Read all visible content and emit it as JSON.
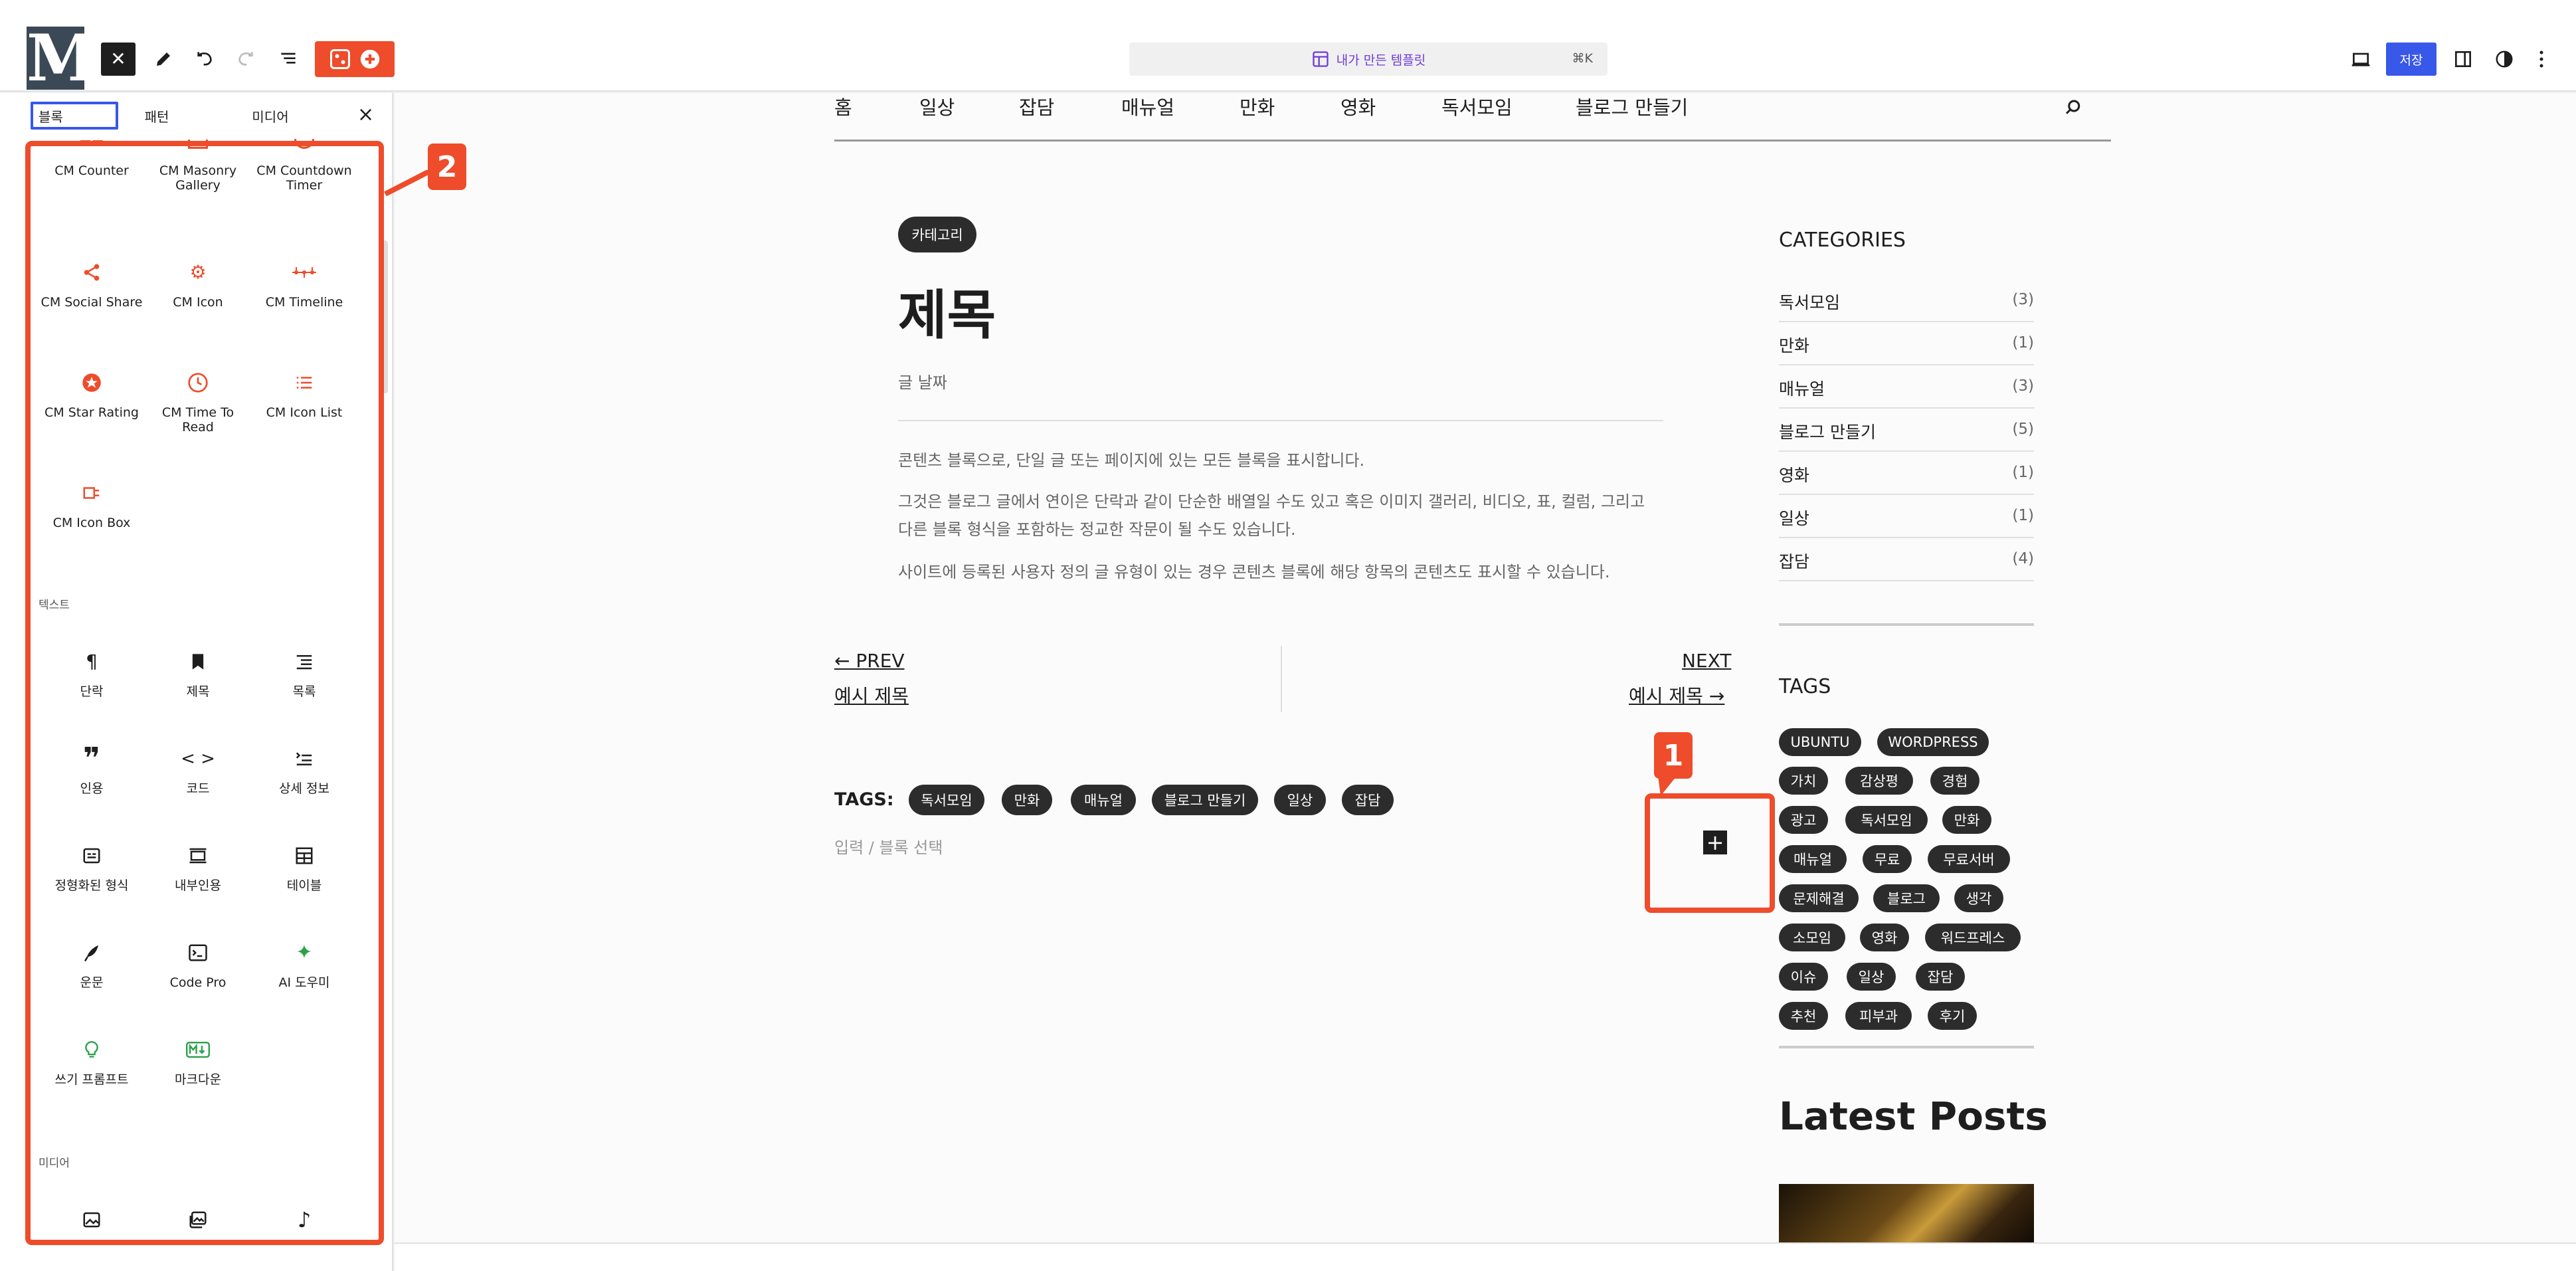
{
  "toolbar": {
    "logo_letter": "M",
    "template_label": "내가 만든 템플릿",
    "shortcut": "⌘K",
    "save_label": "저장",
    "accent": "#ee4c2b",
    "primary": "#3858e9"
  },
  "inserter": {
    "tabs": [
      {
        "label": "블록"
      },
      {
        "label": "패턴"
      },
      {
        "label": "미디어"
      }
    ],
    "blocks": [
      {
        "label": "CM Counter",
        "icon": "counter-icon"
      },
      {
        "label": "CM Masonry Gallery",
        "icon": "masonry-icon"
      },
      {
        "label": "CM Countdown Timer",
        "icon": "timer-icon"
      },
      {
        "label": "CM Social Share",
        "icon": "share-icon"
      },
      {
        "label": "CM Icon",
        "icon": "gear-icon"
      },
      {
        "label": "CM Timeline",
        "icon": "timeline-icon"
      },
      {
        "label": "CM Star Rating",
        "icon": "star-icon"
      },
      {
        "label": "CM Time To Read",
        "icon": "clock-icon"
      },
      {
        "label": "CM Icon List",
        "icon": "list-icon"
      },
      {
        "label": "CM Icon Box",
        "icon": "icon-box-icon"
      }
    ],
    "text_category": "텍스트",
    "text_blocks": [
      {
        "label": "단락",
        "icon": "pilcrow-icon"
      },
      {
        "label": "제목",
        "icon": "bookmark-icon"
      },
      {
        "label": "목록",
        "icon": "list-icon"
      },
      {
        "label": "인용",
        "icon": "quote-icon"
      },
      {
        "label": "코드",
        "icon": "code-icon"
      },
      {
        "label": "상세 정보",
        "icon": "details-icon"
      },
      {
        "label": "정형화된 형식",
        "icon": "preformatted-icon"
      },
      {
        "label": "내부인용",
        "icon": "pullquote-icon"
      },
      {
        "label": "테이블",
        "icon": "table-icon"
      },
      {
        "label": "운문",
        "icon": "quill-icon"
      },
      {
        "label": "Code Pro",
        "icon": "terminal-icon"
      },
      {
        "label": "AI 도우미",
        "icon": "sparkle-icon"
      },
      {
        "label": "쓰기 프롬프트",
        "icon": "bulb-icon"
      },
      {
        "label": "마크다운",
        "icon": "markdown-icon"
      }
    ],
    "media_category": "미디어"
  },
  "annotations": {
    "badge1": "1",
    "badge2": "2"
  },
  "nav": [
    "홈",
    "일상",
    "잡담",
    "매뉴얼",
    "만화",
    "영화",
    "독서모임",
    "블로그 만들기"
  ],
  "post": {
    "category": "카테고리",
    "title": "제목",
    "date": "글 날짜",
    "paragraphs": [
      "콘텐츠 블록으로, 단일 글 또는 페이지에 있는 모든 블록을 표시합니다.",
      "그것은 블로그 글에서 연이은 단락과 같이 단순한 배열일 수도 있고 혹은 이미지 갤러리, 비디오, 표, 컬럼, 그리고 다른 블록 형식을 포함하는 정교한 작문이 될 수도 있습니다.",
      "사이트에 등록된 사용자 정의 글 유형이 있는 경우 콘텐츠 블록에 해당 항목의 콘텐츠도 표시할 수 있습니다."
    ],
    "prev_label": "← PREV",
    "prev_title": "예시 제목",
    "next_label": "NEXT",
    "next_title": "예시 제목 →",
    "tags_label": "TAGS:",
    "tags": [
      "독서모임",
      "만화",
      "매뉴얼",
      "블로그 만들기",
      "일상",
      "잡담"
    ],
    "input_hint": "입력 / 블록 선택"
  },
  "sidebar": {
    "categories_title": "CATEGORIES",
    "categories": [
      {
        "name": "독서모임",
        "count": "(3)"
      },
      {
        "name": "만화",
        "count": "(1)"
      },
      {
        "name": "매뉴얼",
        "count": "(3)"
      },
      {
        "name": "블로그 만들기",
        "count": "(5)"
      },
      {
        "name": "영화",
        "count": "(1)"
      },
      {
        "name": "일상",
        "count": "(1)"
      },
      {
        "name": "잡담",
        "count": "(4)"
      }
    ],
    "tags_title": "TAGS",
    "tags": [
      "UBUNTU",
      "WORDPRESS",
      "가치",
      "감상평",
      "경험",
      "광고",
      "독서모임",
      "만화",
      "매뉴얼",
      "무료",
      "무료서버",
      "문제해결",
      "블로그",
      "생각",
      "소모임",
      "영화",
      "워드프레스",
      "이슈",
      "일상",
      "잡담",
      "추천",
      "피부과",
      "후기"
    ],
    "latest_title": "Latest Posts"
  }
}
